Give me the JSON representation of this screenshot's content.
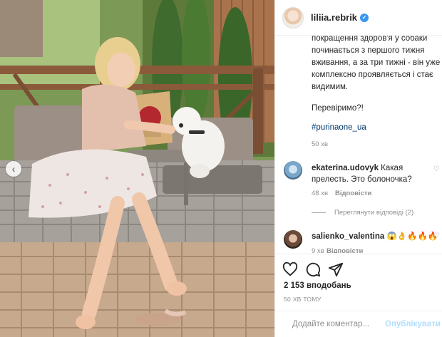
{
  "post": {
    "username": "liliia.rebrik",
    "verified_badge": "✓",
    "caption_cut": "...",
    "caption_tail": "покращення здоров'я у собаки починається з першого тижня вживання, а за три тижні - він уже комплексно проявляється і стає видимим.",
    "caption_question": "Перевіримо?!",
    "hashtag": "#purinaone_ua",
    "time": "50 хв"
  },
  "comments": [
    {
      "username": "ekaterina.udovyk",
      "text": "Какая прелесть. Это болоночка?",
      "time": "48 хв",
      "reply_label": "Відповісти",
      "view_replies": "Переглянути відповіді (2)"
    },
    {
      "username": "salienko_valentina",
      "text": "😱👌🔥🔥🔥",
      "time": "9 хв",
      "reply_label": "Відповісти"
    }
  ],
  "actions": {
    "likes": "2 153 вподобань",
    "posted_ago": "50 ХВ ТОМУ"
  },
  "composer": {
    "placeholder": "Додайте коментар...",
    "publish_label": "Опублікувати"
  },
  "icons": {
    "like": "heart-icon",
    "comment": "comment-bubble-icon",
    "share": "send-icon",
    "emoji": "smiley-icon",
    "prev": "chevron-left-icon",
    "comment_like": "heart-outline-icon"
  },
  "colors": {
    "link": "#00376b",
    "muted": "#8e8e8e",
    "verified": "#3897f0",
    "publish_disabled": "#b2dffc"
  }
}
